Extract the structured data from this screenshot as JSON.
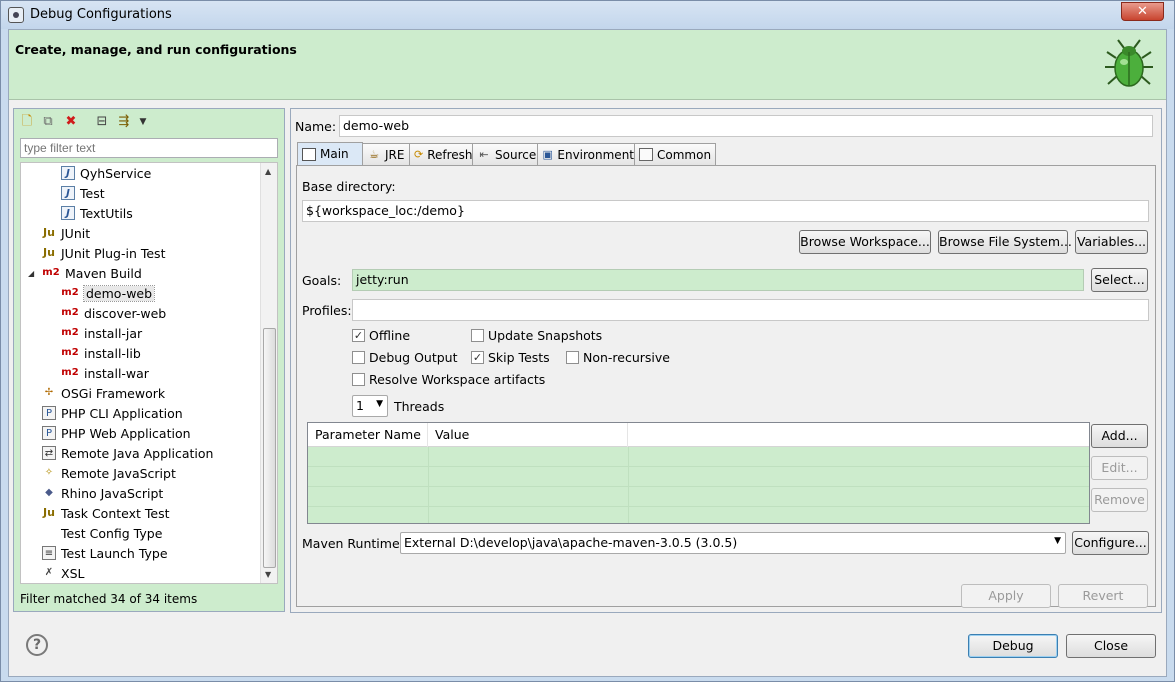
{
  "window": {
    "title": "Debug Configurations",
    "close_glyph": "✕"
  },
  "banner": {
    "text": "Create, manage, and run configurations",
    "icon": "bug-icon"
  },
  "left": {
    "filter_placeholder": "type filter text",
    "toolbar": [
      "new-config-icon",
      "duplicate-icon",
      "delete-icon",
      "collapse-all-icon",
      "filter-icon"
    ],
    "items": [
      {
        "label": "QyhService",
        "icon": "J",
        "level": 2
      },
      {
        "label": "Test",
        "icon": "J",
        "level": 2
      },
      {
        "label": "TextUtils",
        "icon": "J",
        "level": 2
      },
      {
        "label": "JUnit",
        "icon": "Ju",
        "level": 1
      },
      {
        "label": "JUnit Plug-in Test",
        "icon": "Ju",
        "level": 1
      },
      {
        "label": "Maven Build",
        "icon": "m2",
        "level": 1,
        "expanded": true
      },
      {
        "label": "demo-web",
        "icon": "m2",
        "level": 2,
        "selected": true
      },
      {
        "label": "discover-web",
        "icon": "m2",
        "level": 2
      },
      {
        "label": "install-jar",
        "icon": "m2",
        "level": 2
      },
      {
        "label": "install-lib",
        "icon": "m2",
        "level": 2
      },
      {
        "label": "install-war",
        "icon": "m2",
        "level": 2
      },
      {
        "label": "OSGi Framework",
        "icon": "osgi",
        "level": 1
      },
      {
        "label": "PHP CLI Application",
        "icon": "P",
        "level": 1
      },
      {
        "label": "PHP Web Application",
        "icon": "P",
        "level": 1
      },
      {
        "label": "Remote Java Application",
        "icon": "R",
        "level": 1
      },
      {
        "label": "Remote JavaScript",
        "icon": "rjs",
        "level": 1
      },
      {
        "label": "Rhino JavaScript",
        "icon": "rhino",
        "level": 1
      },
      {
        "label": "Task Context Test",
        "icon": "Ju",
        "level": 1
      },
      {
        "label": "Test Config Type",
        "icon": "",
        "level": 1
      },
      {
        "label": "Test Launch Type",
        "icon": "T",
        "level": 1
      },
      {
        "label": "XSL",
        "icon": "xsl",
        "level": 1
      }
    ],
    "status": "Filter matched 34 of 34 items"
  },
  "right": {
    "name_label": "Name:",
    "name_value": "demo-web",
    "tabs": [
      {
        "label": "Main",
        "icon": "main-tab-icon",
        "active": true
      },
      {
        "label": "JRE",
        "icon": "jre-tab-icon"
      },
      {
        "label": "Refresh",
        "icon": "refresh-tab-icon"
      },
      {
        "label": "Source",
        "icon": "source-tab-icon"
      },
      {
        "label": "Environment",
        "icon": "environment-tab-icon"
      },
      {
        "label": "Common",
        "icon": "common-tab-icon"
      }
    ],
    "base_dir_label": "Base directory:",
    "base_dir_value": "${workspace_loc:/demo}",
    "browse_workspace": "Browse Workspace...",
    "browse_fs": "Browse File System...",
    "variables": "Variables...",
    "goals_label": "Goals:",
    "goals_value": "jetty:run",
    "select_btn": "Select...",
    "profiles_label": "Profiles:",
    "profiles_value": "",
    "checkboxes": {
      "offline": {
        "label": "Offline",
        "checked": true
      },
      "update_snapshots": {
        "label": "Update Snapshots",
        "checked": false
      },
      "debug_output": {
        "label": "Debug Output",
        "checked": false
      },
      "skip_tests": {
        "label": "Skip Tests",
        "checked": true
      },
      "non_recursive": {
        "label": "Non-recursive",
        "checked": false
      },
      "resolve_workspace": {
        "label": "Resolve Workspace artifacts",
        "checked": false
      }
    },
    "threads_value": "1",
    "threads_label": "Threads",
    "table_headers": [
      "Parameter Name",
      "Value"
    ],
    "add_btn": "Add...",
    "edit_btn": "Edit...",
    "remove_btn": "Remove",
    "runtime_label": "Maven Runtime:",
    "runtime_value": "External D:\\develop\\java\\apache-maven-3.0.5 (3.0.5)",
    "configure_btn": "Configure...",
    "apply_btn": "Apply",
    "revert_btn": "Revert"
  },
  "footer": {
    "help_glyph": "?",
    "debug_btn": "Debug",
    "close_btn": "Close"
  },
  "colors": {
    "banner": "#cdeccd",
    "m2_icon": "#c00000"
  }
}
